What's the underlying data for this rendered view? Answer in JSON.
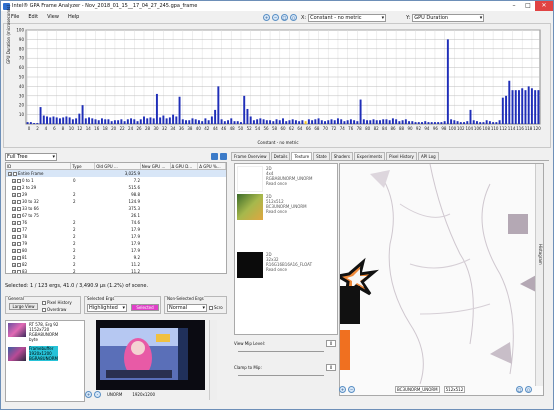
{
  "window": {
    "title": "Intel® GPA Frame Analyzer - Nov_2018_01_15__17_04_27_245.gpa_frame",
    "min": "–",
    "max": "□",
    "close": "✕"
  },
  "menu": [
    "File",
    "Edit",
    "View",
    "Help"
  ],
  "toolbar": {
    "x_label": "X:",
    "x_value": "Constant - no metric",
    "y_label": "Y:",
    "y_value": "GPU Duration"
  },
  "chart_data": {
    "type": "bar",
    "ylabel": "GPU Duration (microseconds)",
    "xlabel": "Constant - no metric",
    "ylim": [
      0,
      100
    ],
    "yticks": [
      10,
      20,
      30,
      40,
      50,
      60,
      70,
      80,
      90,
      100
    ],
    "categories": [
      "0",
      "2",
      "4",
      "6",
      "8",
      "10",
      "12",
      "14",
      "16",
      "18",
      "20",
      "22",
      "24",
      "26",
      "28",
      "30",
      "32",
      "34",
      "36",
      "38",
      "40",
      "42",
      "44",
      "46",
      "48",
      "50",
      "52",
      "54",
      "56",
      "58",
      "60",
      "62",
      "64",
      "66",
      "68",
      "70",
      "72",
      "74",
      "76",
      "78",
      "80",
      "82",
      "84",
      "86",
      "88",
      "90",
      "92",
      "94",
      "96",
      "98",
      "100",
      "102",
      "104",
      "106",
      "108",
      "110",
      "112",
      "114",
      "116",
      "118",
      "120"
    ],
    "values": [
      2,
      2,
      1,
      1,
      18,
      9,
      8,
      7,
      8,
      7,
      6,
      7,
      8,
      7,
      5,
      6,
      11,
      20,
      6,
      7,
      6,
      5,
      4,
      6,
      5,
      5,
      3,
      4,
      4,
      5,
      3,
      5,
      6,
      5,
      3,
      5,
      8,
      6,
      7,
      6,
      32,
      7,
      9,
      6,
      7,
      10,
      8,
      29,
      5,
      4,
      4,
      6,
      5,
      4,
      3,
      6,
      4,
      8,
      15,
      40,
      5,
      3,
      4,
      6,
      3,
      3,
      2,
      30,
      16,
      8,
      4,
      5,
      6,
      5,
      4,
      4,
      3,
      5,
      4,
      6,
      3,
      4,
      5,
      4,
      3,
      4,
      3,
      5,
      4,
      5,
      6,
      4,
      3,
      4,
      5,
      4,
      6,
      5,
      3,
      4,
      5,
      4,
      3,
      26,
      5,
      4,
      4,
      5,
      4,
      4,
      5,
      5,
      4,
      6,
      5,
      3,
      4,
      5,
      3,
      3,
      2,
      2,
      2,
      3,
      2,
      2,
      2,
      2,
      2,
      3,
      90,
      5,
      4,
      3,
      2,
      2,
      3,
      15,
      4,
      3,
      2,
      2,
      4,
      3,
      2,
      2,
      4,
      28,
      30,
      46,
      36,
      36,
      36,
      38,
      36,
      40,
      38,
      36,
      36
    ],
    "highlight_index": 86,
    "highlight_color": "#f0c020",
    "bar_color": "#1f2eb8",
    "grid": true
  },
  "tree": {
    "view": "Full Tree",
    "columns": [
      "ID",
      "Type",
      "Old GPU ...",
      "New GPU ...",
      "Δ GPU D...",
      "Δ GPU D...",
      "Δ GPU %..."
    ],
    "rows": [
      {
        "id": "Entire Frame",
        "type": "",
        "gpu": "3,025.9",
        "level": 0,
        "sel": true
      },
      {
        "id": "0 to 1",
        "type": "0",
        "gpu": "7.2",
        "level": 1
      },
      {
        "id": "2 to 29",
        "type": "",
        "gpu": "515.6",
        "level": 1
      },
      {
        "id": "29",
        "type": "2",
        "gpu": "98.8",
        "level": 1
      },
      {
        "id": "30 to 32",
        "type": "2",
        "gpu": "124.9",
        "level": 1
      },
      {
        "id": "33 to 66",
        "type": "",
        "gpu": "375.3",
        "level": 1
      },
      {
        "id": "67 to 75",
        "type": "",
        "gpu": "26.1",
        "level": 1
      },
      {
        "id": "76",
        "type": "2",
        "gpu": "74.6",
        "level": 1
      },
      {
        "id": "77",
        "type": "2",
        "gpu": "17.9",
        "level": 1
      },
      {
        "id": "78",
        "type": "2",
        "gpu": "17.9",
        "level": 1
      },
      {
        "id": "79",
        "type": "2",
        "gpu": "17.9",
        "level": 1
      },
      {
        "id": "80",
        "type": "2",
        "gpu": "17.9",
        "level": 1
      },
      {
        "id": "81",
        "type": "2",
        "gpu": "9.2",
        "level": 1
      },
      {
        "id": "82",
        "type": "2",
        "gpu": "11.2",
        "level": 1
      },
      {
        "id": "83",
        "type": "2",
        "gpu": "11.2",
        "level": 1
      }
    ]
  },
  "status": "Selected: 1 / 123 ergs, 41.0 / 3,490.9 μs (1.2%) of scene.",
  "general": {
    "title": "General",
    "large_view": "Large View",
    "pixel_history": "Pixel History",
    "overdraw": "Overdraw"
  },
  "selected_ergs": {
    "title": "Selected Ergs",
    "value": "Highlighted",
    "button": "Selected"
  },
  "nonselected_ergs": {
    "title": "Non-Selected Ergs",
    "value": "Normal",
    "scroll": "Scro"
  },
  "thumbnails": [
    {
      "text": "RT 578, Erg 92\n1152x720\nRGBA8UNORM\nbyte"
    },
    {
      "text": "Framebuffer\n1920x1200\nBGRA8UNORM"
    }
  ],
  "preview_footer": {
    "zoom_in": "+",
    "zoom_out": "-",
    "fmt": "UNORM",
    "size": "1920x1200"
  },
  "tabs": [
    "Frame Overview",
    "Details",
    "Texture",
    "State",
    "Shaders",
    "Experiments",
    "Pixel History",
    "API Log"
  ],
  "active_tab": "Texture",
  "textures": [
    {
      "text": "2D\n4x4\nRGBA8UNORM_UNORM\nRead once"
    },
    {
      "text": "2D\n512x512\nBC3UNORM_UNORM\nRead once"
    },
    {
      "text": "2D\n32x32\nR16G16B16A16_FLOAT\nRead once"
    }
  ],
  "mips": {
    "view_level": "View Mip Level:",
    "view_val": "0",
    "clamp": "Clamp to Mip:",
    "clamp_val": "0"
  },
  "canvas_footer": {
    "fmt": "BC3UNORM_UNORM",
    "size": "512x512"
  },
  "side_label": "Histogram"
}
